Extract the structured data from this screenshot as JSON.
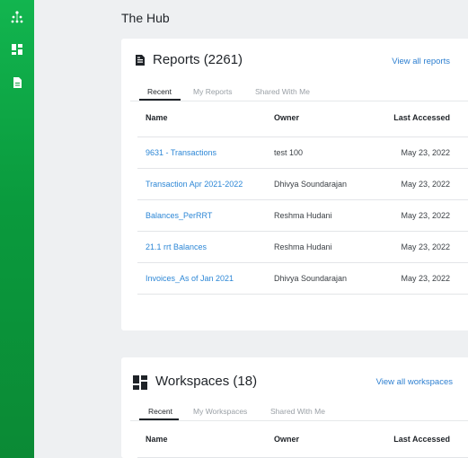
{
  "sidebar": {
    "items": [
      {
        "icon": "hub-network-icon"
      },
      {
        "icon": "dashboard-icon"
      },
      {
        "icon": "report-document-icon"
      }
    ]
  },
  "page": {
    "title": "The Hub"
  },
  "reports": {
    "title": "Reports (2261)",
    "view_all": "View all reports",
    "tabs": [
      "Recent",
      "My Reports",
      "Shared With Me"
    ],
    "columns": [
      "Name",
      "Owner",
      "Last Accessed"
    ],
    "rows": [
      {
        "name": "9631 - Transactions",
        "owner": "test 100",
        "date": "May 23, 2022"
      },
      {
        "name": "Transaction Apr 2021-2022",
        "owner": "Dhivya Soundarajan",
        "date": "May 23, 2022"
      },
      {
        "name": "Balances_PerRRT",
        "owner": "Reshma Hudani",
        "date": "May 23, 2022"
      },
      {
        "name": "21.1 rrt Balances",
        "owner": "Reshma Hudani",
        "date": "May 23, 2022"
      },
      {
        "name": "Invoices_As of Jan 2021",
        "owner": "Dhivya Soundarajan",
        "date": "May 23, 2022"
      }
    ]
  },
  "workspaces": {
    "title": "Workspaces (18)",
    "view_all": "View all workspaces",
    "tabs": [
      "Recent",
      "My Workspaces",
      "Shared With Me"
    ],
    "columns": [
      "Name",
      "Owner",
      "Last Accessed"
    ]
  },
  "colors": {
    "sidebar_green": "#0ea444",
    "link_blue": "#2d87d6",
    "background": "#eef0f2"
  }
}
